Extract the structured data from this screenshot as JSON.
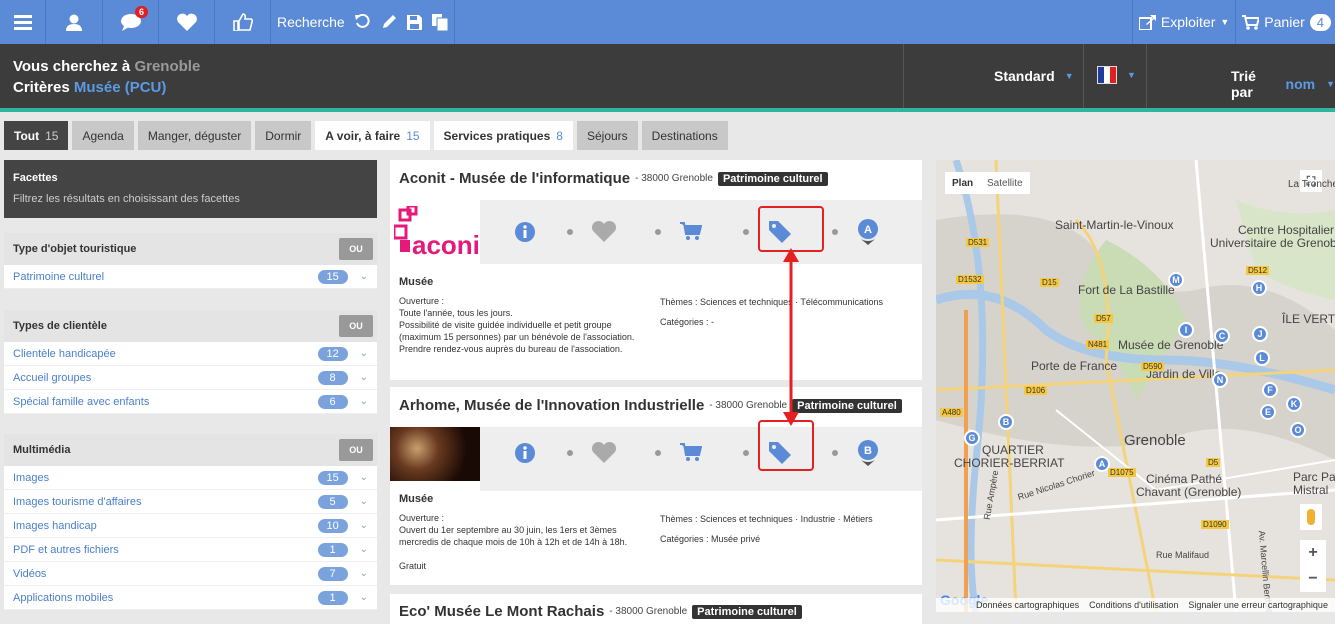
{
  "topbar": {
    "badge": "6",
    "search": "Recherche",
    "export": "Exploiter",
    "cart": "Panier",
    "cart_count": "4"
  },
  "search": {
    "line1_label": "Vous cherchez à",
    "line1_value": "Grenoble",
    "line2_label": "Critères",
    "line2_value": "Musée (PCU)",
    "view": "Standard",
    "sort_label": "Trié par",
    "sort_value": "nom"
  },
  "tabs": [
    {
      "label": "Tout",
      "count": "15"
    },
    {
      "label": "Agenda",
      "count": ""
    },
    {
      "label": "Manger, déguster",
      "count": ""
    },
    {
      "label": "Dormir",
      "count": ""
    },
    {
      "label": "A voir, à faire",
      "count": "15"
    },
    {
      "label": "Services pratiques",
      "count": "8"
    },
    {
      "label": "Séjours",
      "count": ""
    },
    {
      "label": "Destinations",
      "count": ""
    }
  ],
  "facets": {
    "title": "Facettes",
    "subtitle": "Filtrez les résultats en choisissant des facettes",
    "ou": "OU",
    "groups": [
      {
        "title": "Type d'objet touristique",
        "items": [
          {
            "label": "Patrimoine culturel",
            "count": "15"
          }
        ]
      },
      {
        "title": "Types de clientèle",
        "items": [
          {
            "label": "Clientèle handicapée",
            "count": "12"
          },
          {
            "label": "Accueil groupes",
            "count": "8"
          },
          {
            "label": "Spécial famille avec enfants",
            "count": "6"
          }
        ]
      },
      {
        "title": "Multimédia",
        "items": [
          {
            "label": "Images",
            "count": "15"
          },
          {
            "label": "Images tourisme d'affaires",
            "count": "5"
          },
          {
            "label": "Images handicap",
            "count": "10"
          },
          {
            "label": "PDF et autres fichiers",
            "count": "1"
          },
          {
            "label": "Vidéos",
            "count": "7"
          },
          {
            "label": "Applications mobiles",
            "count": "1"
          }
        ]
      }
    ]
  },
  "cards": [
    {
      "title": "Aconit - Musée de l'informatique",
      "city": "- 38000 Grenoble",
      "category": "Patrimoine culturel",
      "marker": "A",
      "logo": "aconit",
      "type": "Musée",
      "opening_label": "Ouverture :",
      "opening": [
        "Toute l'année, tous les jours.",
        "Possibilité de visite guidée individuelle et petit groupe",
        "(maximum 15 personnes) par un bénévole de l'association.",
        "Prendre rendez-vous auprès du bureau de l'association."
      ],
      "themes_label": "Thèmes :",
      "themes": "Sciences et techniques · Télécommunications",
      "categories_label": "Catégories :",
      "categories": "-",
      "price": ""
    },
    {
      "title": "Arhome, Musée de l'Innovation Industrielle",
      "city": "- 38000 Grenoble",
      "category": "Patrimoine culturel",
      "marker": "B",
      "type": "Musée",
      "opening_label": "Ouverture :",
      "opening": [
        "Ouvert du 1er septembre au 30 juin, les 1ers et 3èmes",
        "mercredis de chaque mois de 10h à 12h et de 14h à 18h."
      ],
      "themes_label": "Thèmes :",
      "themes": "Sciences et techniques · Industrie · Métiers",
      "categories_label": "Catégories :",
      "categories": "Musée privé",
      "price": "Gratuit"
    },
    {
      "title": "Eco' Musée Le Mont Rachais",
      "city": "- 38000 Grenoble",
      "category": "Patrimoine culturel"
    }
  ],
  "map": {
    "plan": "Plan",
    "satellite": "Satellite",
    "google": "Google",
    "footer": [
      "Données cartographiques",
      "Conditions d'utilisation",
      "Signaler une erreur cartographique"
    ],
    "labels": [
      "Saint-Martin-le-Vinoux",
      "Centre Hospitalier",
      "Universitaire de Grenoble",
      "Fort de La Bastille",
      "Musée de Grenoble",
      "Porte de France",
      "Jardin de Ville",
      "Grenoble",
      "QUARTIER",
      "CHORIER-BERRIAT",
      "Cinéma Pathé",
      "Chavant (Grenoble)",
      "Parc Paul",
      "Mistral",
      "ÎLE VERTE",
      "La Tronche",
      "Rue Nicolas Chorier",
      "Rue Ampère",
      "Rue Malifaud",
      "Av. Marcellin Berthelot"
    ],
    "roads": [
      "D531",
      "D15",
      "D512",
      "D1532",
      "D106",
      "N481",
      "D57",
      "D590",
      "D1075",
      "D5",
      "D1090",
      "A480"
    ],
    "pins": [
      "M",
      "H",
      "I",
      "C",
      "J",
      "L",
      "N",
      "F",
      "E",
      "K",
      "O",
      "B",
      "G",
      "A"
    ]
  },
  "colors": {
    "topbar": "#5b8ad6",
    "accent": "#2fb4a0",
    "highlight": "#e52020"
  }
}
